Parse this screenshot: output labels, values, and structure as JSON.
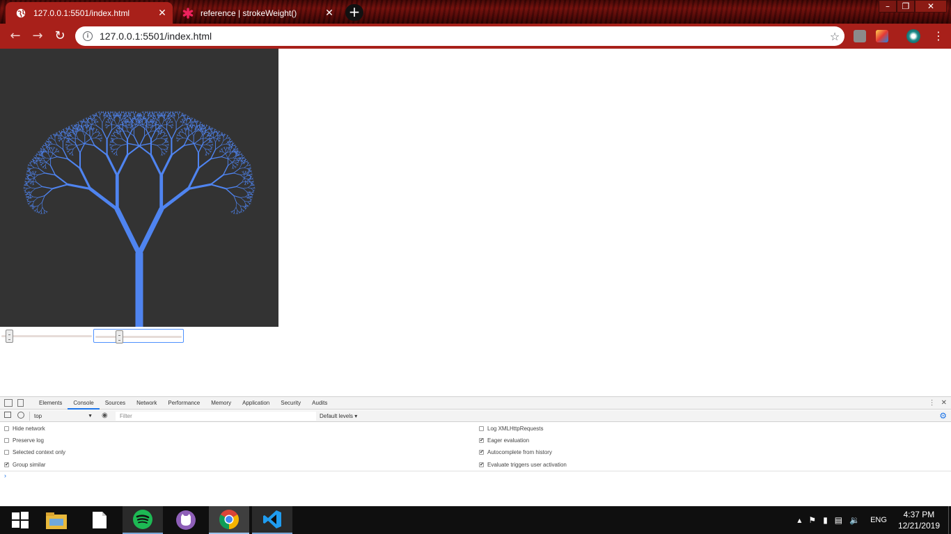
{
  "browser": {
    "tabs": [
      {
        "title": "127.0.0.1:5501/index.html",
        "active": true,
        "favicon": "globe-icon"
      },
      {
        "title": "reference | strokeWeight()",
        "active": false,
        "favicon": "p5-asterisk-icon"
      }
    ],
    "new_tab_label": "+",
    "address": "127.0.0.1:5501/index.html",
    "window_controls": {
      "minimize": "–",
      "maximize": "❐",
      "close": "✕"
    }
  },
  "page": {
    "canvas_bg": "#333333",
    "tree_color": "#4f84f0",
    "sliders": [
      {
        "name": "slider-1",
        "value": 0.05,
        "focused": false
      },
      {
        "name": "slider-2",
        "value": 0.25,
        "focused": true
      }
    ]
  },
  "devtools": {
    "tabs": [
      "Elements",
      "Console",
      "Sources",
      "Network",
      "Performance",
      "Memory",
      "Application",
      "Security",
      "Audits"
    ],
    "selected_tab": "Console",
    "context": "top",
    "filter_placeholder": "Filter",
    "levels": "Default levels ▾",
    "left_options": [
      {
        "label": "Hide network",
        "checked": false
      },
      {
        "label": "Preserve log",
        "checked": false
      },
      {
        "label": "Selected context only",
        "checked": false
      },
      {
        "label": "Group similar",
        "checked": true
      }
    ],
    "right_options": [
      {
        "label": "Log XMLHttpRequests",
        "checked": false
      },
      {
        "label": "Eager evaluation",
        "checked": true
      },
      {
        "label": "Autocomplete from history",
        "checked": true
      },
      {
        "label": "Evaluate triggers user activation",
        "checked": true
      }
    ],
    "prompt": "›"
  },
  "taskbar": {
    "lang": "ENG",
    "time": "4:37 PM",
    "date": "12/21/2019"
  }
}
